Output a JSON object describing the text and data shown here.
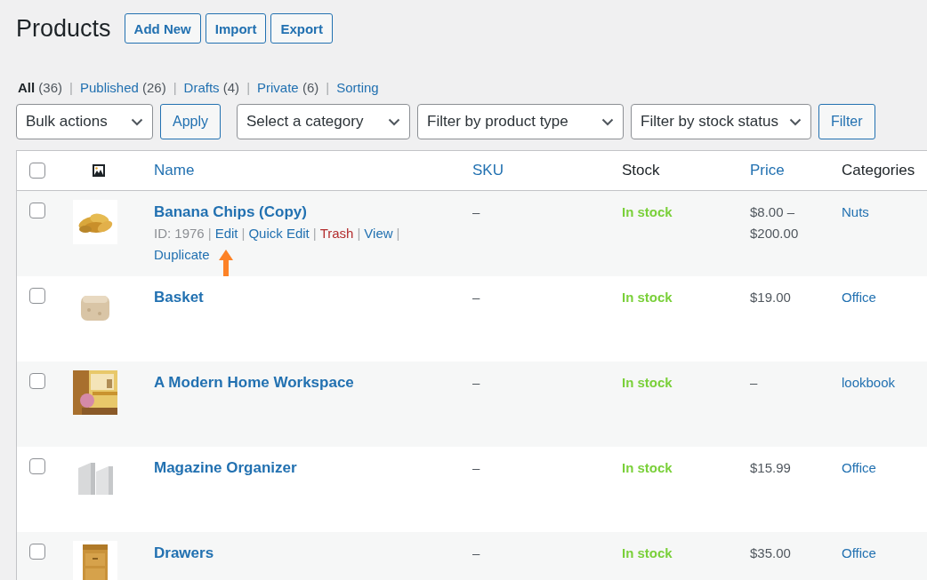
{
  "page": {
    "title": "Products",
    "buttons": [
      "Add New",
      "Import",
      "Export"
    ]
  },
  "views": {
    "separator": "|",
    "items": [
      {
        "label": "All",
        "count": "(36)",
        "selected": true
      },
      {
        "label": "Published",
        "count": "(26)",
        "selected": false
      },
      {
        "label": "Drafts",
        "count": "(4)",
        "selected": false
      },
      {
        "label": "Private",
        "count": "(6)",
        "selected": false
      },
      {
        "label": "Sorting",
        "selected": false
      }
    ]
  },
  "toolbar": {
    "bulk_actions": "Bulk actions",
    "apply": "Apply",
    "filters": [
      "Select a category",
      "Filter by product type",
      "Filter by stock status"
    ],
    "filter_button": "Filter"
  },
  "table": {
    "select_all": {
      "checked": false
    },
    "columns": [
      {
        "label": "Name",
        "sortable": true
      },
      {
        "label": "SKU",
        "sortable": true
      },
      {
        "label": "Stock",
        "sortable": false
      },
      {
        "label": "Price",
        "sortable": true
      },
      {
        "label": "Categories",
        "sortable": false
      }
    ],
    "rows": [
      {
        "checked": false,
        "thumb": {
          "kind": "chips"
        },
        "name": "Banana Chips (Copy)",
        "sku": "–",
        "stock": {
          "label": "In stock",
          "kind": "instock"
        },
        "price": "$8.00 – $200.00",
        "category": "Nuts",
        "actions": {
          "separator": "|",
          "items": [
            {
              "label": "ID: 1976",
              "kind": "meta"
            },
            {
              "label": "Edit",
              "kind": "arrowed"
            },
            {
              "label": "Quick Edit",
              "kind": "link"
            },
            {
              "label": "Trash",
              "kind": "danger"
            },
            {
              "label": "View",
              "kind": "link"
            },
            {
              "label": "Duplicate",
              "kind": "link"
            }
          ]
        }
      },
      {
        "checked": false,
        "thumb": {
          "kind": "basket"
        },
        "name": "Basket",
        "sku": "–",
        "stock": {
          "label": "In stock",
          "kind": "instock"
        },
        "price": "$19.00",
        "category": "Office"
      },
      {
        "checked": false,
        "thumb": {
          "kind": "workspace"
        },
        "name": "A Modern Home Workspace",
        "sku": "–",
        "stock": {
          "label": "In stock",
          "kind": "instock"
        },
        "price": "–",
        "category": "lookbook"
      },
      {
        "checked": false,
        "thumb": {
          "kind": "organizer"
        },
        "name": "Magazine Organizer",
        "sku": "–",
        "stock": {
          "label": "In stock",
          "kind": "instock"
        },
        "price": "$15.99",
        "category": "Office"
      },
      {
        "checked": false,
        "thumb": {
          "kind": "drawers"
        },
        "name": "Drawers",
        "sku": "–",
        "stock": {
          "label": "In stock",
          "kind": "instock"
        },
        "price": "$35.00",
        "category": "Office"
      }
    ]
  }
}
